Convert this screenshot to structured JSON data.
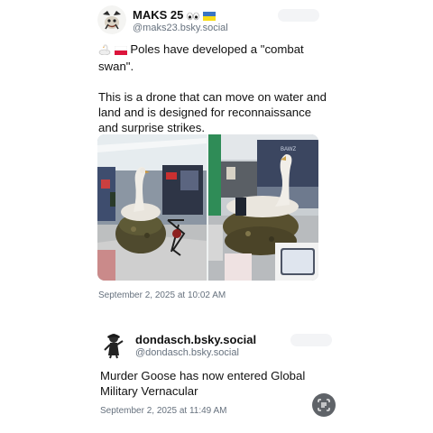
{
  "post1": {
    "display_name": "MAKS 25",
    "name_emojis": [
      "eyes-emoji",
      "ukraine-flag-emoji"
    ],
    "handle": "@maks23.bsky.social",
    "text_line1": "Poles have developed a \"combat swan\".",
    "text_line2": "This is a drone that can move on water and land and is designed for reconnaissance and surprise strikes.",
    "text_emojis": [
      "swan-emoji",
      "poland-flag-emoji"
    ],
    "media_alt": "swan-shaped drone photos",
    "timestamp": "September 2, 2025 at 10:02 AM"
  },
  "post2": {
    "display_name": "dondasch.bsky.social",
    "handle": "@dondasch.bsky.social",
    "text": "Murder Goose has now entered Global Military Vernacular",
    "timestamp": "September 2, 2025 at 11:49 AM"
  },
  "colors": {
    "text": "#111111",
    "secondary": "#66717e",
    "lens_button": "#5f6368"
  }
}
